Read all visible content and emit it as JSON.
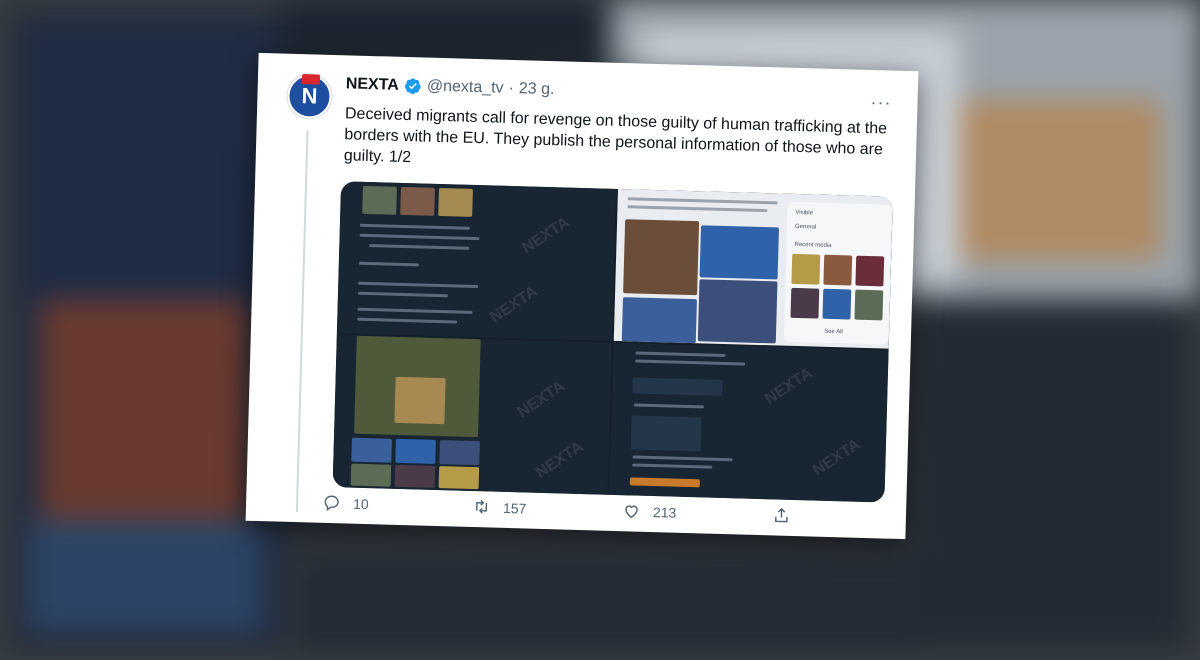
{
  "tweet": {
    "author_name": "NEXTA",
    "author_handle": "@nexta_tv",
    "separator": "·",
    "time": "23 g.",
    "avatar_letter": "N",
    "text": "Deceived migrants call for revenge on those guilty of human trafficking at the borders with the EU. They publish the personal information of those who are guilty. 1/2",
    "more_label": "···"
  },
  "media": {
    "watermark": "NEXTA",
    "panel": {
      "recent_media_label": "Recent media",
      "see_all_label": "See All",
      "visible_label": "Visible",
      "general_label": "General"
    }
  },
  "actions": {
    "reply_count": "10",
    "retweet_count": "157",
    "like_count": "213"
  },
  "icons": {
    "verified": "verified-badge-icon",
    "reply": "reply-icon",
    "retweet": "retweet-icon",
    "like": "heart-icon",
    "share": "share-icon",
    "more": "more-options-icon"
  },
  "colors": {
    "brand_blue": "#1d9bf0",
    "text_primary": "#0f1419",
    "text_secondary": "#536471",
    "media_bg": "#15202b"
  }
}
